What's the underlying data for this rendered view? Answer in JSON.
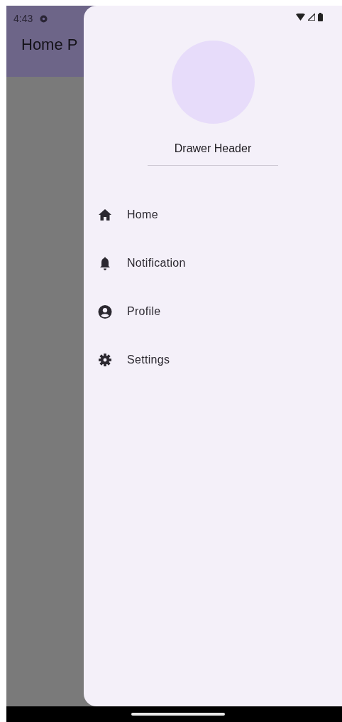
{
  "status_bar": {
    "time": "4:43"
  },
  "app_bar": {
    "title": "Home P"
  },
  "drawer": {
    "header": {
      "title": "Drawer Header"
    },
    "items": [
      {
        "label": "Home"
      },
      {
        "label": "Notification"
      },
      {
        "label": "Profile"
      },
      {
        "label": "Settings"
      }
    ]
  }
}
